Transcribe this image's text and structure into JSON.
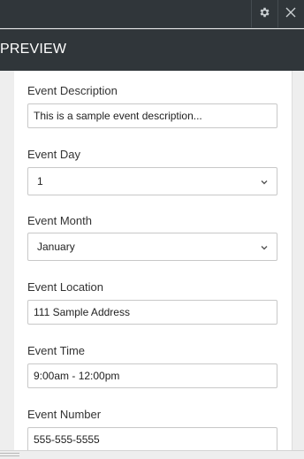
{
  "header": {
    "title": "PREVIEW"
  },
  "toolbar": {
    "settings_icon": "gear-icon",
    "close_icon": "close-icon"
  },
  "form": {
    "description": {
      "label": "Event Description",
      "value": "This is a sample event description..."
    },
    "day": {
      "label": "Event Day",
      "value": "1"
    },
    "month": {
      "label": "Event Month",
      "value": "January"
    },
    "location": {
      "label": "Event Location",
      "value": "111 Sample Address"
    },
    "time": {
      "label": "Event Time",
      "value": "9:00am - 12:00pm"
    },
    "number": {
      "label": "Event Number",
      "value": "555-555-5555"
    }
  },
  "colors": {
    "header_bg": "#30363a",
    "panel_bg": "#ffffff",
    "border": "#c8c8c8"
  }
}
